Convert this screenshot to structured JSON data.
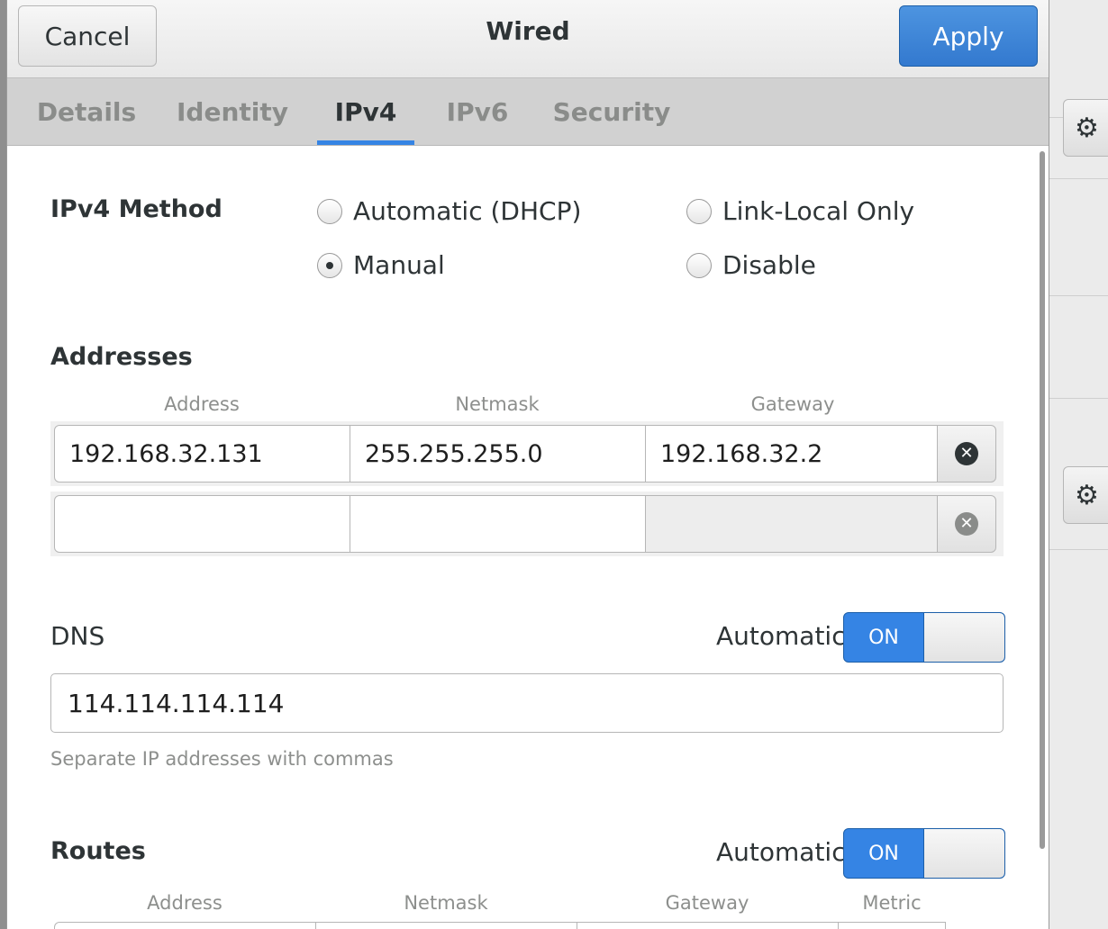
{
  "dialog": {
    "title": "Wired",
    "cancel_label": "Cancel",
    "apply_label": "Apply"
  },
  "tabs": [
    {
      "label": "Details",
      "active": false
    },
    {
      "label": "Identity",
      "active": false
    },
    {
      "label": "IPv4",
      "active": true
    },
    {
      "label": "IPv6",
      "active": false
    },
    {
      "label": "Security",
      "active": false
    }
  ],
  "ipv4_method": {
    "label": "IPv4 Method",
    "options": [
      {
        "label": "Automatic (DHCP)",
        "checked": false
      },
      {
        "label": "Link-Local Only",
        "checked": false
      },
      {
        "label": "Manual",
        "checked": true
      },
      {
        "label": "Disable",
        "checked": false
      }
    ]
  },
  "addresses": {
    "label": "Addresses",
    "columns": [
      "Address",
      "Netmask",
      "Gateway"
    ],
    "rows": [
      {
        "address": "192.168.32.131",
        "netmask": "255.255.255.0",
        "gateway": "192.168.32.2"
      },
      {
        "address": "",
        "netmask": "",
        "gateway": ""
      }
    ]
  },
  "dns": {
    "label": "DNS",
    "automatic_label": "Automatic",
    "switch_text": "ON",
    "switch_on": true,
    "value": "114.114.114.114",
    "hint": "Separate IP addresses with commas"
  },
  "routes": {
    "label": "Routes",
    "automatic_label": "Automatic",
    "switch_text": "ON",
    "switch_on": true,
    "columns": [
      "Address",
      "Netmask",
      "Gateway",
      "Metric"
    ]
  },
  "icons": {
    "gear": "gear-icon",
    "delete": "remove-row-icon"
  },
  "colors": {
    "accent": "#3584e4",
    "header_bg": "#e8e8e8",
    "tabs_bg": "#d1d1d1"
  }
}
